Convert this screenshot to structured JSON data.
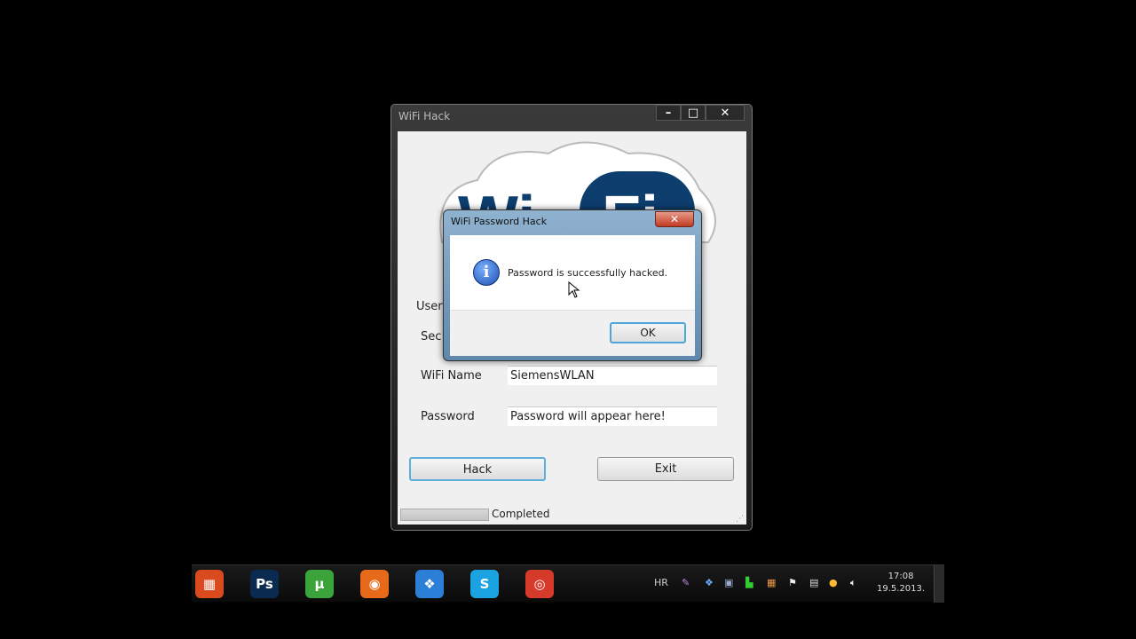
{
  "main_window": {
    "title": "WiFi Hack",
    "logo_text": "WiFi",
    "labels": {
      "user": "User",
      "security": "Sec",
      "wifi_name": "WiFi Name",
      "password": "Password"
    },
    "wifi_name_value": "SiemensWLAN",
    "password_value": "Password will appear here!",
    "hack_label": "Hack",
    "exit_label": "Exit",
    "status": "Completed",
    "progress_percent": 100
  },
  "dialog": {
    "title": "WiFi Password Hack",
    "message": "Password is successfully hacked.",
    "ok_label": "OK",
    "info_glyph": "i"
  },
  "taskbar": {
    "apps": [
      {
        "name": "avg-icon",
        "glyph": "▦",
        "color": "#d94a1e"
      },
      {
        "name": "photoshop-icon",
        "glyph": "Ps",
        "color": "#0b2a4f"
      },
      {
        "name": "utorrent-icon",
        "glyph": "µ",
        "color": "#3aa33a"
      },
      {
        "name": "firefox-icon",
        "glyph": "◉",
        "color": "#e66a1a"
      },
      {
        "name": "dropbox-icon",
        "glyph": "❖",
        "color": "#2b7fd6"
      },
      {
        "name": "skype-icon",
        "glyph": "S",
        "color": "#1aa3e0"
      },
      {
        "name": "chrome-icon",
        "glyph": "◎",
        "color": "#d53a2a"
      }
    ],
    "language": "HR",
    "time": "17:08",
    "date": "19.5.2013."
  }
}
